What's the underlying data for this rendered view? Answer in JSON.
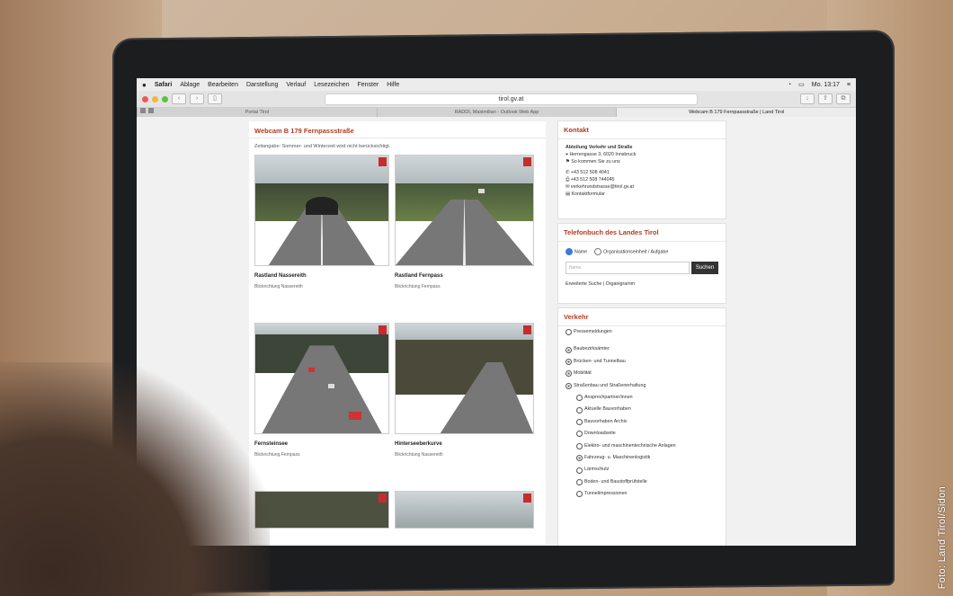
{
  "menubar": {
    "apple": "",
    "app": "Safari",
    "items": [
      "Ablage",
      "Bearbeiten",
      "Darstellung",
      "Verlauf",
      "Lesezeichen",
      "Fenster",
      "Hilfe"
    ],
    "clock": "Mo. 13:17"
  },
  "toolbar": {
    "url": "tirol.gv.at"
  },
  "tabs": [
    "Portal Tirol",
    "RADDI, Maximilian - Outlook Web App",
    "Webcam B 179 Fernpassstraße | Land Tirol"
  ],
  "main": {
    "title": "Webcam B 179 Fernpassstraße",
    "note": "Zeitangabe: Sommer- und Winterzeit wird nicht berücksichtigt.",
    "cams": [
      {
        "name": "Rastland Nassereith",
        "dir": "Blickrichtung Nassereith"
      },
      {
        "name": "Rastland Fernpass",
        "dir": "Blickrichtung Fernpass"
      },
      {
        "name": "Fernsteinsee",
        "dir": "Blickrichtung Fernpass"
      },
      {
        "name": "Hinterseeberkurve",
        "dir": "Blickrichtung Nassereith"
      }
    ]
  },
  "kontakt": {
    "title": "Kontakt",
    "org": "Abteilung Verkehr und Straße",
    "address": "Herrengasse 3, 6020 Innsbruck",
    "directions": "So kommen Sie zu uns",
    "phone": "+43 512 508 4041",
    "fax": "+43 512 508 744045",
    "email": "verkehrundstrasse@tirol.gv.at",
    "form": "Kontaktformular"
  },
  "telefonbuch": {
    "title": "Telefonbuch des Landes Tirol",
    "radio1": "Name",
    "radio2": "Organisationseinheit / Aufgabe",
    "placeholder": "Name",
    "button": "Suchen",
    "links": "Erweiterte Suche | Organigramm"
  },
  "verkehr": {
    "title": "Verkehr",
    "items": [
      {
        "label": "Pressemeldungen",
        "sub": false,
        "checked": false
      },
      {
        "label": "Baubezirksämter",
        "sub": false,
        "checked": true
      },
      {
        "label": "Brücken- und Tunnelbau",
        "sub": false,
        "checked": true
      },
      {
        "label": "Mobilität",
        "sub": false,
        "checked": true
      },
      {
        "label": "Straßenbau und Straßenerhaltung",
        "sub": false,
        "checked": true
      },
      {
        "label": "Ansprechpartner/innen",
        "sub": true,
        "checked": false
      },
      {
        "label": "Aktuelle Bauvorhaben",
        "sub": true,
        "checked": false
      },
      {
        "label": "Bauvorhaben Archiv",
        "sub": true,
        "checked": false
      },
      {
        "label": "Downloadseite",
        "sub": true,
        "checked": false
      },
      {
        "label": "Elektro- und maschinentechnische Anlagen",
        "sub": true,
        "checked": false
      },
      {
        "label": "Fahrzeug- u. Maschinenlogistik",
        "sub": true,
        "checked": true
      },
      {
        "label": "Lärmschutz",
        "sub": true,
        "checked": false
      },
      {
        "label": "Boden- und Baustoffprüfstelle",
        "sub": true,
        "checked": false
      },
      {
        "label": "Tunnelimpressionen",
        "sub": true,
        "checked": false
      }
    ]
  },
  "credit": "Foto: Land Tirol/Sidon"
}
